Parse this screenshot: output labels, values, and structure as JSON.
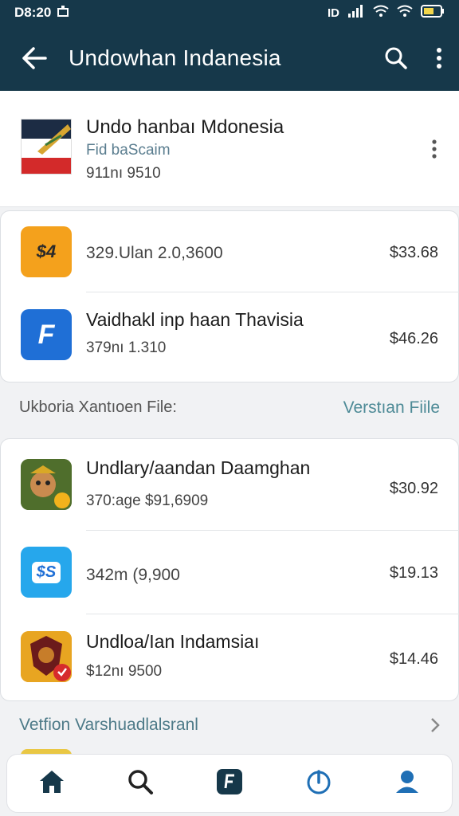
{
  "status_bar": {
    "time": "D8:20",
    "right_label": "ID"
  },
  "app_bar": {
    "title": "Undowhan Indanesia"
  },
  "header": {
    "title": "Undo hanbaı Mdonesia",
    "subtitle": "Fid baScaim",
    "meta": "911nı 9510"
  },
  "group1": [
    {
      "title": "",
      "meta": "329.Ulan 2.0,3600",
      "price": "$33.68",
      "icon": "tag-icon",
      "icon_text": "$4",
      "color": "#f4a11c"
    },
    {
      "title": "Vaidhakl inp haan Thavisia",
      "meta": "379nı 1.310",
      "price": "$46.26",
      "icon": "flag-app-icon",
      "icon_text": "F",
      "color": "#1f6fd6"
    }
  ],
  "section1": {
    "left": "Ukboria Xantıoen File:",
    "right": "Verstıan Fiile"
  },
  "group2": [
    {
      "title": "Undlary/aandan Daamghan",
      "meta": "370:age $91,6909",
      "price": "$30.92",
      "icon": "game-icon",
      "icon_text": "",
      "color": "#6b8a3a"
    },
    {
      "title": "",
      "meta": "342m (9,900",
      "price": "$19.13",
      "icon": "dollar-app-icon",
      "icon_text": "$S",
      "color": "#26a7ec"
    },
    {
      "title": "Undloa/Ian Indamsiaı",
      "meta": "$12nı 9500",
      "price": "$14.46",
      "icon": "shield-game-icon",
      "icon_text": "",
      "color": "#e8a521"
    }
  ],
  "section2": {
    "left": "Vetfion Varshuadlalsranl"
  },
  "nav": [
    "home-icon",
    "search-icon",
    "f-app-icon",
    "power-icon",
    "profile-icon"
  ]
}
